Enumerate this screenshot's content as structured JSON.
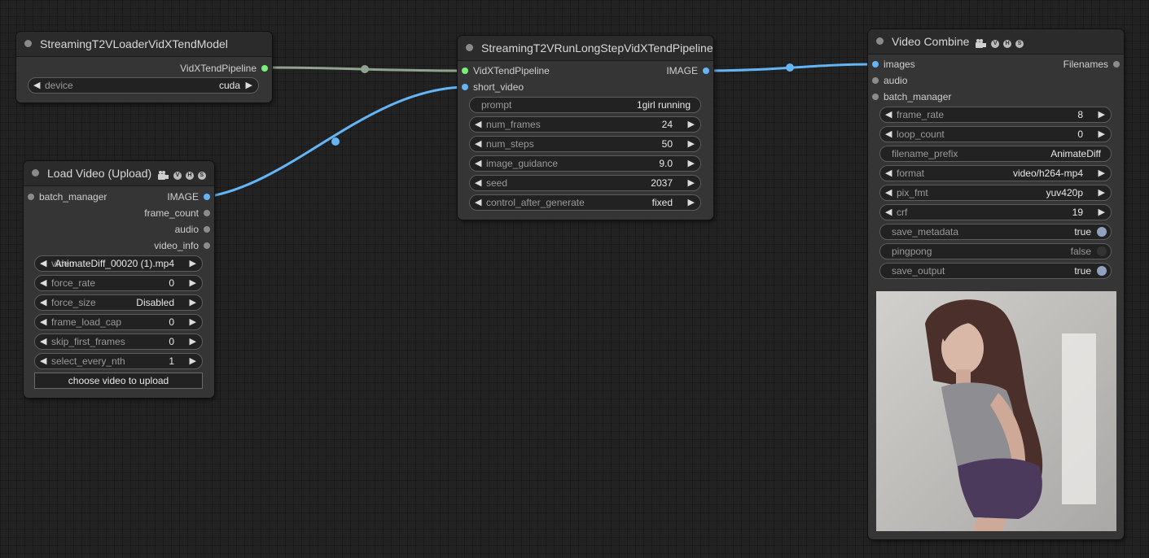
{
  "colors": {
    "canvas_bg": "#222222",
    "node_bg": "#353535",
    "node_title_bg": "#2b2b2b",
    "link_blue": "#64b5f6",
    "link_green": "#8fa38f",
    "slot_green": "#7bef7b"
  },
  "nodes": {
    "loader": {
      "title": "StreamingT2VLoaderVidXTendModel",
      "outputs": [
        "VidXTendPipeline"
      ],
      "widgets": {
        "device": {
          "name": "device",
          "value": "cuda"
        }
      }
    },
    "load_video": {
      "title": "Load Video (Upload)",
      "badge_icon": "film-camera-icon",
      "badges": [
        "V",
        "H",
        "S"
      ],
      "inputs": [
        "batch_manager"
      ],
      "outputs": [
        "IMAGE",
        "frame_count",
        "audio",
        "video_info"
      ],
      "widgets": {
        "video": {
          "name": "video",
          "value": "AnimateDiff_00020 (1).mp4"
        },
        "force_rate": {
          "name": "force_rate",
          "value": "0"
        },
        "force_size": {
          "name": "force_size",
          "value": "Disabled"
        },
        "frame_load_cap": {
          "name": "frame_load_cap",
          "value": "0"
        },
        "skip_first_frames": {
          "name": "skip_first_frames",
          "value": "0"
        },
        "select_every_nth": {
          "name": "select_every_nth",
          "value": "1"
        }
      },
      "upload_button": "choose video to upload"
    },
    "run_pipeline": {
      "title": "StreamingT2VRunLongStepVidXTendPipeline",
      "inputs": [
        "VidXTendPipeline",
        "short_video"
      ],
      "outputs": [
        "IMAGE"
      ],
      "widgets": {
        "prompt": {
          "name": "prompt",
          "value": "1girl running"
        },
        "num_frames": {
          "name": "num_frames",
          "value": "24"
        },
        "num_steps": {
          "name": "num_steps",
          "value": "50"
        },
        "image_guidance": {
          "name": "image_guidance",
          "value": "9.0"
        },
        "seed": {
          "name": "seed",
          "value": "2037"
        },
        "control_after_generate": {
          "name": "control_after_generate",
          "value": "fixed"
        }
      }
    },
    "video_combine": {
      "title": "Video Combine",
      "badge_icon": "film-camera-icon",
      "badges": [
        "V",
        "H",
        "S"
      ],
      "inputs": [
        "images",
        "audio",
        "batch_manager"
      ],
      "outputs": [
        "Filenames"
      ],
      "widgets": {
        "frame_rate": {
          "name": "frame_rate",
          "value": "8"
        },
        "loop_count": {
          "name": "loop_count",
          "value": "0"
        },
        "filename_prefix": {
          "name": "filename_prefix",
          "value": "AnimateDiff"
        },
        "format": {
          "name": "format",
          "value": "video/h264-mp4"
        },
        "pix_fmt": {
          "name": "pix_fmt",
          "value": "yuv420p"
        },
        "crf": {
          "name": "crf",
          "value": "19"
        },
        "save_metadata": {
          "name": "save_metadata",
          "value": "true"
        },
        "pingpong": {
          "name": "pingpong",
          "value": "false"
        },
        "save_output": {
          "name": "save_output",
          "value": "true"
        }
      }
    }
  }
}
